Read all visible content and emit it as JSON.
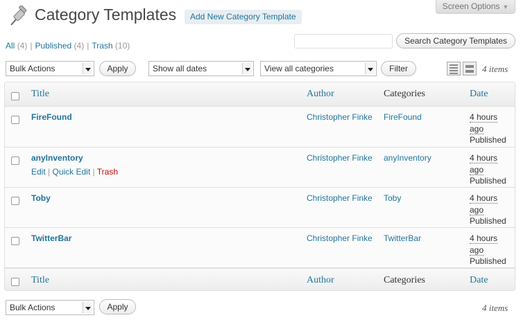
{
  "header": {
    "title": "Category Templates",
    "add_new_label": "Add New Category Template",
    "screen_options_label": "Screen Options"
  },
  "filters_links": {
    "all": {
      "label": "All",
      "count": "(4)"
    },
    "published": {
      "label": "Published",
      "count": "(4)"
    },
    "trash": {
      "label": "Trash",
      "count": "(10)"
    },
    "separator": "|"
  },
  "search": {
    "value": "",
    "button_label": "Search Category Templates"
  },
  "toolbar_top": {
    "bulk_actions": "Bulk Actions",
    "apply_label": "Apply",
    "dates_filter": "Show all dates",
    "categories_filter": "View all categories",
    "filter_label": "Filter",
    "items_count": "4 items"
  },
  "toolbar_bottom": {
    "bulk_actions": "Bulk Actions",
    "apply_label": "Apply",
    "items_count": "4 items"
  },
  "table": {
    "columns": {
      "title": "Title",
      "author": "Author",
      "categories": "Categories",
      "date": "Date"
    },
    "rows": [
      {
        "title": "FireFound",
        "author": "Christopher Finke",
        "category": "FireFound",
        "date_line1": "4 hours",
        "date_line2": "ago",
        "status": "Published"
      },
      {
        "title": "anyInventory",
        "author": "Christopher Finke",
        "category": "anyInventory",
        "date_line1": "4 hours",
        "date_line2": "ago",
        "status": "Published",
        "actions": {
          "edit": "Edit",
          "quick_edit": "Quick Edit",
          "trash": "Trash",
          "separator": "|"
        }
      },
      {
        "title": "Toby",
        "author": "Christopher Finke",
        "category": "Toby",
        "date_line1": "4 hours",
        "date_line2": "ago",
        "status": "Published"
      },
      {
        "title": "TwitterBar",
        "author": "Christopher Finke",
        "category": "TwitterBar",
        "date_line1": "4 hours",
        "date_line2": "ago",
        "status": "Published"
      }
    ]
  },
  "colors": {
    "link": "#21759b",
    "trash": "#bc0b0b",
    "title": "#464646"
  },
  "icons": {
    "page": "pushpin-icon",
    "list_view": "list-view-icon",
    "excerpt_view": "excerpt-view-icon"
  }
}
